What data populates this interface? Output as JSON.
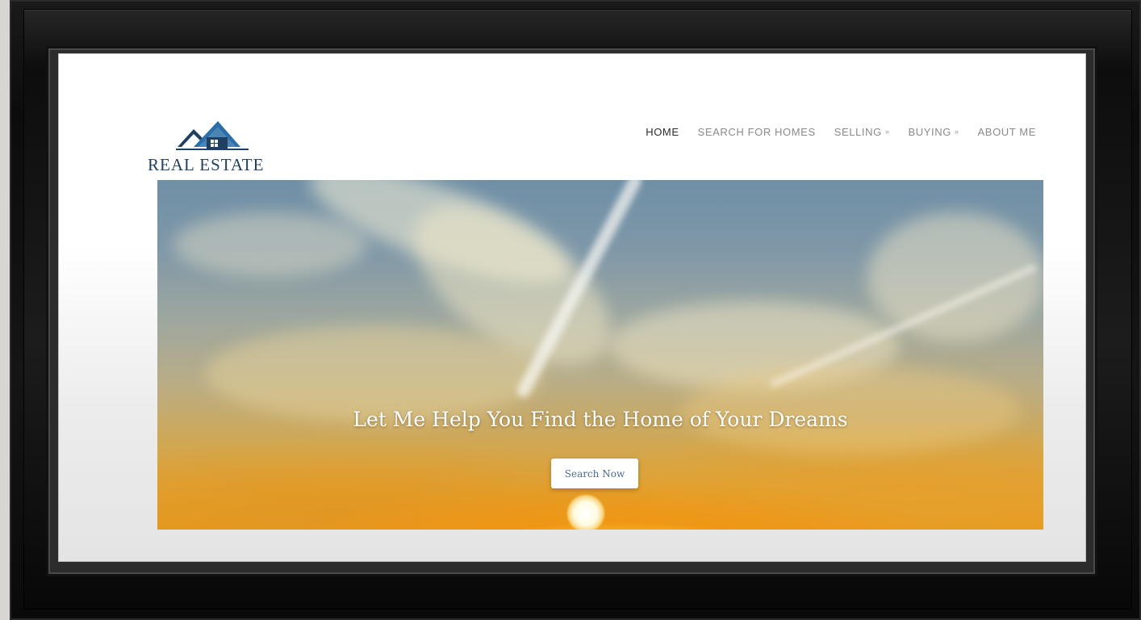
{
  "brand": {
    "logo_text": "REAL ESTATE"
  },
  "nav": {
    "items": [
      {
        "label": "HOME",
        "active": true,
        "has_dropdown": false
      },
      {
        "label": "SEARCH FOR HOMES",
        "active": false,
        "has_dropdown": false
      },
      {
        "label": "SELLING",
        "active": false,
        "has_dropdown": true
      },
      {
        "label": "BUYING",
        "active": false,
        "has_dropdown": true
      },
      {
        "label": "ABOUT ME",
        "active": false,
        "has_dropdown": false
      }
    ],
    "dropdown_glyph": "»"
  },
  "hero": {
    "title": "Let Me Help You Find the Home of Your Dreams",
    "button_label": "Search Now"
  },
  "colors": {
    "brand_navy": "#1f3f63",
    "brand_blue": "#2d6ea8",
    "nav_active": "#2b2b2b",
    "nav_inactive": "#8a8a8a",
    "button_text": "#4a6c8c"
  },
  "icons": {
    "logo": "house-roofs-icon",
    "dropdown": "double-chevron-down-icon"
  }
}
